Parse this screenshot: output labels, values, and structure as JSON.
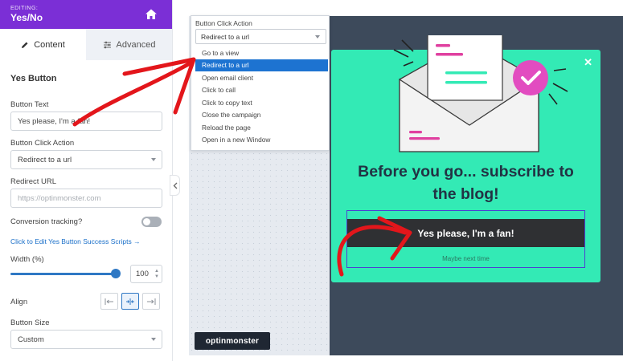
{
  "header": {
    "editing_label": "EDITING:",
    "title": "Yes/No"
  },
  "tabs": [
    {
      "label": "Content"
    },
    {
      "label": "Advanced"
    }
  ],
  "section": {
    "title": "Yes Button"
  },
  "fields": {
    "button_text": {
      "label": "Button Text",
      "value": "Yes please, I'm a fan!"
    },
    "button_click_action": {
      "label": "Button Click Action",
      "value": "Redirect to a url"
    },
    "redirect_url": {
      "label": "Redirect URL",
      "placeholder": "https://optinmonster.com"
    },
    "conversion_tracking": {
      "label": "Conversion tracking?",
      "enabled": false
    },
    "success_scripts_link": "Click to Edit Yes Button Success Scripts →",
    "width": {
      "label": "Width (%)",
      "value": "100",
      "level_percent": 100
    },
    "align": {
      "label": "Align",
      "selected": "center"
    },
    "button_size": {
      "label": "Button Size",
      "value": "Custom"
    }
  },
  "dropdown": {
    "label": "Button Click Action",
    "value": "Redirect to a url",
    "options": [
      "Go to a view",
      "Redirect to a url",
      "Open email client",
      "Click to call",
      "Click to copy text",
      "Close the campaign",
      "Reload the page",
      "Open in a new Window"
    ],
    "selected_index": 1
  },
  "popup": {
    "headline_line1": "Before you go... subscribe to",
    "headline_line2": "the blog!",
    "cta": "Yes please, I'm a fan!",
    "secondary": "Maybe next time",
    "close_glyph": "✕"
  },
  "brand": {
    "logo_text": "optinmonster"
  },
  "colors": {
    "header": "#7b2fd6",
    "popup_bg": "#33eab5",
    "accent": "#2f78c4",
    "annotation": "#e3161b",
    "canvas_dark": "#3d4a5b"
  },
  "icons": [
    "home-icon",
    "pencil-icon",
    "sliders-icon",
    "chevron-down-icon",
    "chevron-left-icon",
    "align-left-icon",
    "align-center-icon",
    "align-right-icon",
    "close-icon",
    "envelope-icon",
    "check-badge-icon"
  ]
}
